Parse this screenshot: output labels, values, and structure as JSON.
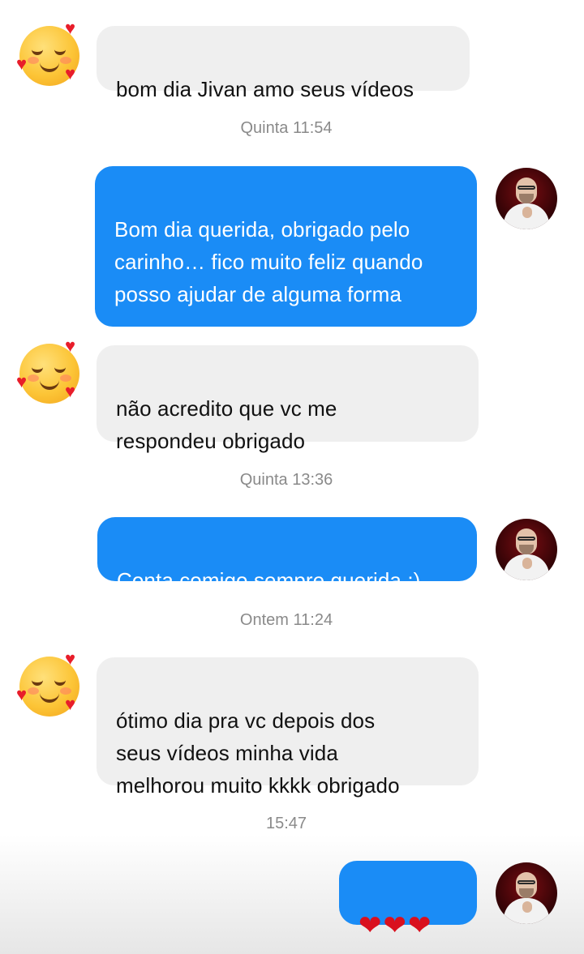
{
  "conversation": {
    "messages": [
      {
        "direction": "incoming",
        "text": "bom dia Jivan amo seus vídeos"
      },
      {
        "direction": "timestamp",
        "text": "Quinta 11:54"
      },
      {
        "direction": "outgoing",
        "text": "Bom dia querida, obrigado pelo\ncarinho… fico muito feliz quando\nposso ajudar de alguma forma"
      },
      {
        "direction": "incoming",
        "text": "não acredito que vc me\nrespondeu obrigado"
      },
      {
        "direction": "timestamp",
        "text": "Quinta 13:36"
      },
      {
        "direction": "outgoing",
        "text": "Conta comigo sempre querida :)"
      },
      {
        "direction": "timestamp",
        "text": "Ontem 11:24"
      },
      {
        "direction": "incoming",
        "text": "ótimo dia pra vc   depois dos\nseus vídeos minha vida\nmelhorou muito  kkkk obrigado"
      },
      {
        "direction": "timestamp",
        "text": "15:47"
      },
      {
        "direction": "outgoing",
        "text": "❤❤❤"
      }
    ]
  },
  "icons": {
    "incoming_avatar": "smiling-face-with-hearts-icon",
    "outgoing_avatar": "profile-photo",
    "heart": "❤"
  },
  "colors": {
    "outgoing_bubble": "#1a8cf6",
    "incoming_bubble": "#efefef",
    "timestamp_text": "#8a8a8a",
    "heart": "#d9101e"
  }
}
